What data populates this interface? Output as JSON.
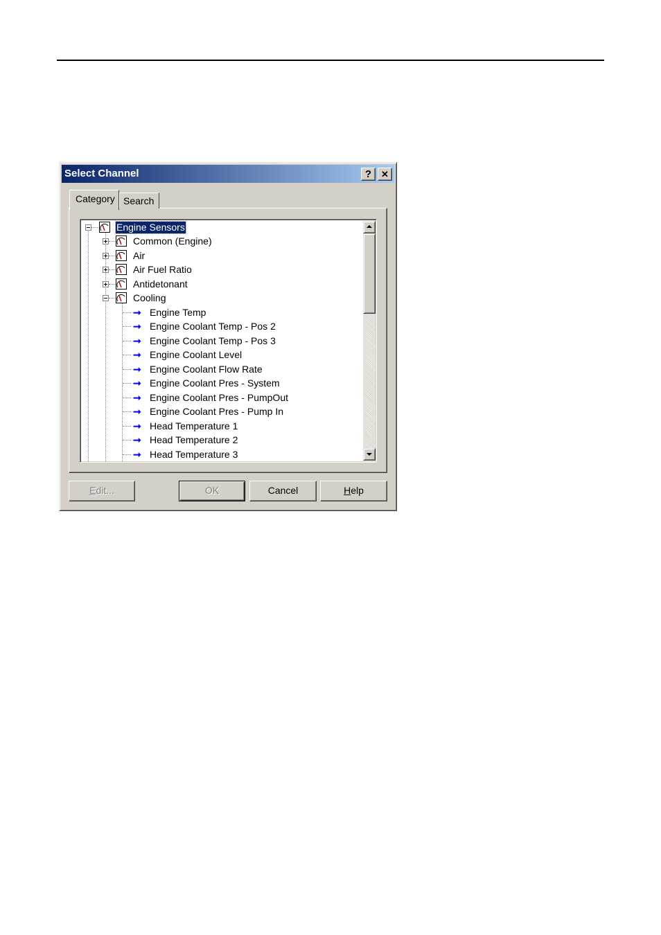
{
  "dialog": {
    "title": "Select Channel",
    "help_glyph": "?",
    "close_glyph": "✕"
  },
  "tabs": [
    {
      "label": "Category",
      "active": true
    },
    {
      "label": "Search",
      "active": false
    }
  ],
  "tree": {
    "root": {
      "label": "Engine Sensors",
      "icon": "gauge-icon",
      "expanded": true,
      "selected": true
    },
    "groups": [
      {
        "label": "Common (Engine)",
        "icon": "gauge-icon",
        "expanded": false
      },
      {
        "label": "Air",
        "icon": "gauge-icon",
        "expanded": false
      },
      {
        "label": "Air Fuel Ratio",
        "icon": "gauge-icon",
        "expanded": false
      },
      {
        "label": "Antidetonant",
        "icon": "gauge-icon",
        "expanded": false
      },
      {
        "label": "Cooling",
        "icon": "gauge-icon",
        "expanded": true
      }
    ],
    "channels": [
      {
        "label": "Engine Temp",
        "icon": "arrow-right-icon"
      },
      {
        "label": "Engine Coolant Temp - Pos 2",
        "icon": "arrow-right-icon"
      },
      {
        "label": "Engine Coolant Temp - Pos 3",
        "icon": "arrow-right-icon"
      },
      {
        "label": "Engine Coolant Level",
        "icon": "arrow-right-icon"
      },
      {
        "label": "Engine Coolant Flow Rate",
        "icon": "arrow-right-icon"
      },
      {
        "label": "Engine Coolant Pres - System",
        "icon": "arrow-right-icon"
      },
      {
        "label": "Engine Coolant Pres - PumpOut",
        "icon": "arrow-right-icon"
      },
      {
        "label": "Engine Coolant Pres - Pump In",
        "icon": "arrow-right-icon"
      },
      {
        "label": "Head Temperature 1",
        "icon": "arrow-right-icon"
      },
      {
        "label": "Head Temperature 2",
        "icon": "arrow-right-icon"
      },
      {
        "label": "Head Temperature 3",
        "icon": "arrow-right-icon"
      }
    ]
  },
  "buttons": {
    "edit": {
      "label": "Edit...",
      "mnemonic": "E",
      "rest": "dit...",
      "enabled": false
    },
    "ok": {
      "label": "OK",
      "enabled": false
    },
    "cancel": {
      "label": "Cancel",
      "enabled": true
    },
    "help": {
      "label": "Help",
      "mnemonic": "H",
      "rest": "elp",
      "enabled": true
    }
  },
  "colors": {
    "titlebar_start": "#0a246a",
    "titlebar_end": "#a6caf0",
    "face": "#d4d0c8",
    "arrow": "#0000ff",
    "gauge_needle": "#c00000"
  }
}
